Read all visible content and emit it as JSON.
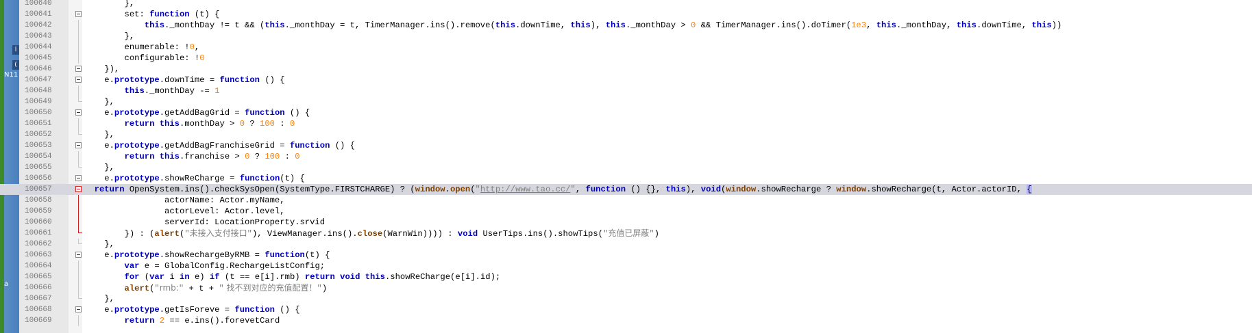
{
  "side_panel": {
    "label_top": "N11",
    "label_bottom": "a"
  },
  "lines": [
    {
      "n": "100640",
      "text": "        },"
    },
    {
      "n": "100641",
      "text": "        set: function (t) {"
    },
    {
      "n": "100642",
      "text": "            this._monthDay != t && (this._monthDay = t, TimerManager.ins().remove(this.downTime, this), this._monthDay > 0 && TimerManager.ins().doTimer(1e3, this._monthDay, this.downTime, this))"
    },
    {
      "n": "100643",
      "text": "        },"
    },
    {
      "n": "100644",
      "text": "        enumerable: !0,"
    },
    {
      "n": "100645",
      "text": "        configurable: !0"
    },
    {
      "n": "100646",
      "text": "    }),"
    },
    {
      "n": "100647",
      "text": "    e.prototype.downTime = function () {"
    },
    {
      "n": "100648",
      "text": "        this._monthDay -= 1"
    },
    {
      "n": "100649",
      "text": "    },"
    },
    {
      "n": "100650",
      "text": "    e.prototype.getAddBagGrid = function () {"
    },
    {
      "n": "100651",
      "text": "        return this.monthDay > 0 ? 100 : 0"
    },
    {
      "n": "100652",
      "text": "    },"
    },
    {
      "n": "100653",
      "text": "    e.prototype.getAddBagFranchiseGrid = function () {"
    },
    {
      "n": "100654",
      "text": "        return this.franchise > 0 ? 100 : 0"
    },
    {
      "n": "100655",
      "text": "    },"
    },
    {
      "n": "100656",
      "text": "    e.prototype.showReCharge = function(t) {"
    },
    {
      "n": "100657",
      "text": "  return OpenSystem.ins().checkSysOpen(SystemType.FIRSTCHARGE) ? (window.open(\"http://www.tao.cc/\", function () {}, this), void(window.showRecharge ? window.showRecharge(t, Actor.actorID, {"
    },
    {
      "n": "100658",
      "text": "                actorName: Actor.myName,"
    },
    {
      "n": "100659",
      "text": "                actorLevel: Actor.level,"
    },
    {
      "n": "100660",
      "text": "                serverId: LocationProperty.srvid"
    },
    {
      "n": "100661",
      "text": "        }) : (alert(\"未接入支付接口\"), ViewManager.ins().close(WarnWin)))) : void UserTips.ins().showTips(\"充值已屏蔽\")"
    },
    {
      "n": "100662",
      "text": "    },"
    },
    {
      "n": "100663",
      "text": "    e.prototype.showRechargeByRMB = function(t) {"
    },
    {
      "n": "100664",
      "text": "        var e = GlobalConfig.RechargeListConfig;"
    },
    {
      "n": "100665",
      "text": "        for (var i in e) if (t == e[i].rmb) return void this.showReCharge(e[i].id);"
    },
    {
      "n": "100666",
      "text": "        alert(\"rmb:\" + t + \" 找不到对应的充值配置！\")"
    },
    {
      "n": "100667",
      "text": "    },"
    },
    {
      "n": "100668",
      "text": "    e.prototype.getIsForeve = function () {"
    },
    {
      "n": "100669",
      "text": "        return 2 == e.ins().forevetCard"
    }
  ]
}
